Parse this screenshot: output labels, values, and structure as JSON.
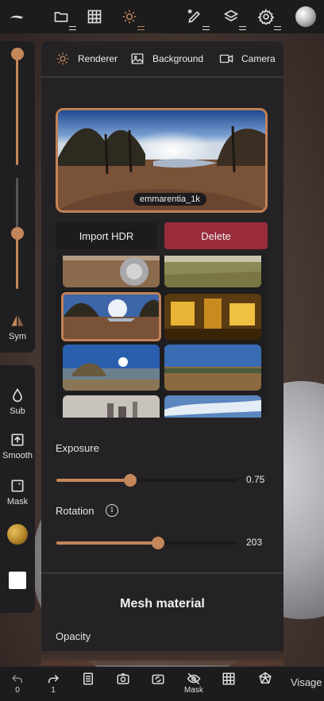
{
  "panel": {
    "tabs": [
      {
        "label": "Renderer"
      },
      {
        "label": "Background"
      },
      {
        "label": "Camera"
      }
    ],
    "hdr": {
      "current_name": "emmarentia_1k",
      "import_label": "Import HDR",
      "delete_label": "Delete"
    },
    "exposure": {
      "label": "Exposure",
      "value": "0.75",
      "fraction": 0.41
    },
    "rotation": {
      "label": "Rotation",
      "value": "203",
      "fraction": 0.56
    },
    "section_title": "Mesh material",
    "opacity_label": "Opacity"
  },
  "left_tools": {
    "sym_label": "Sym",
    "sub_label": "Sub",
    "smooth_label": "Smooth",
    "mask_label": "Mask"
  },
  "bottom_bar": {
    "undo_count": "0",
    "redo_count": "1",
    "mask_label": "Mask",
    "visage_label": "Visage"
  },
  "colors": {
    "accent": "#c4875a",
    "delete": "#9a2c3a",
    "panel_bg": "#242225"
  }
}
